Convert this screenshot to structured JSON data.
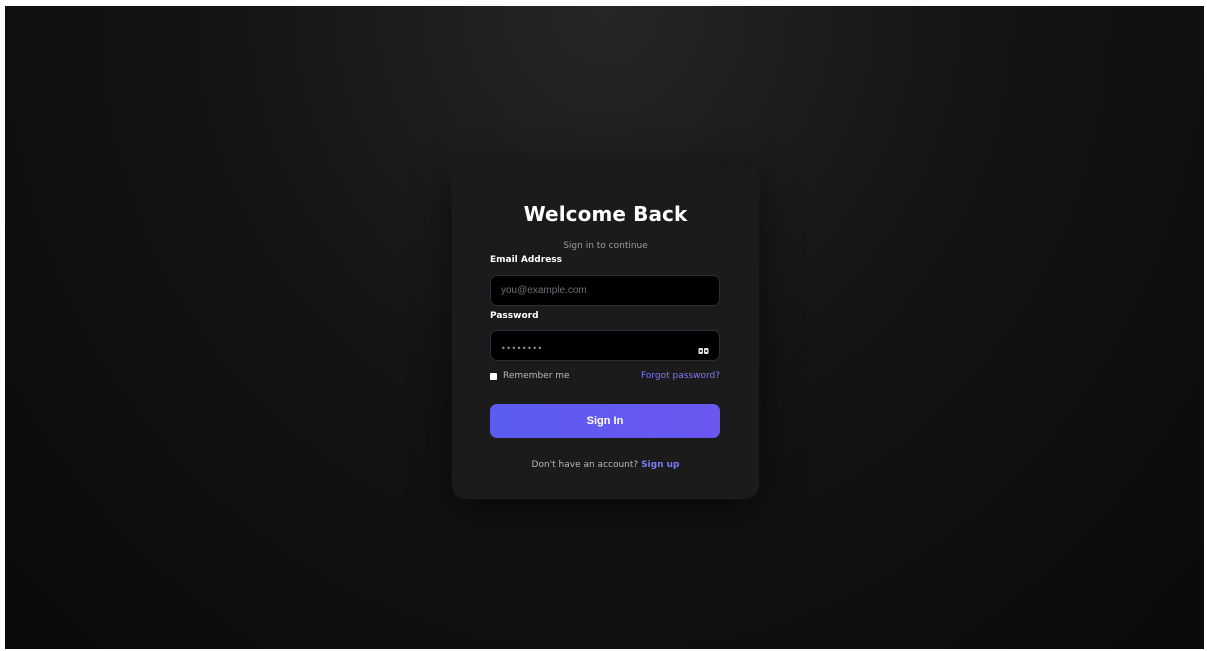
{
  "login": {
    "title": "Welcome Back",
    "subtitle": "Sign in to continue",
    "email_label": "Email Address",
    "email_placeholder": "you@example.com",
    "password_label": "Password",
    "password_value": "••••••••",
    "password_toggle_icon": "eye-icon",
    "remember_label": "Remember me",
    "remember_checked": false,
    "forgot_label": "Forgot password?",
    "submit_label": "Sign In",
    "signup_prompt": "Don't have an account?",
    "signup_link": "Sign up"
  },
  "colors": {
    "accent": "#6366f1",
    "link": "#7b7bf6",
    "card_bg": "#1b1b1c",
    "page_bg": "#0a0a0a"
  }
}
